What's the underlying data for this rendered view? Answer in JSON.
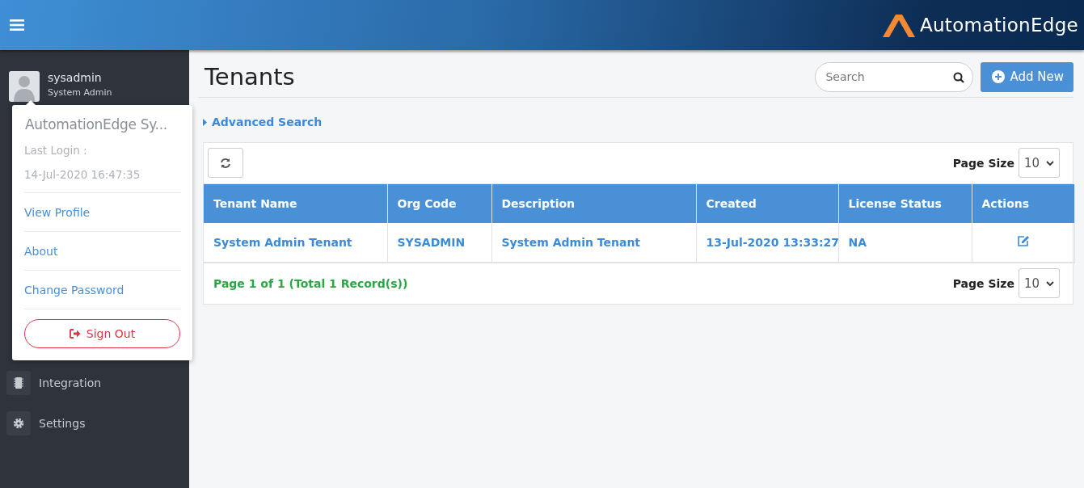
{
  "header": {
    "logo_text": "AutomationEdge"
  },
  "user": {
    "name": "sysadmin",
    "role": "System Admin"
  },
  "profile_menu": {
    "title": "AutomationEdge Sy...",
    "last_login_label": "Last Login :",
    "last_login": "14-Jul-2020 16:47:35",
    "links": [
      "View Profile",
      "About",
      "Change Password"
    ],
    "sign_out": "Sign Out"
  },
  "sidebar": {
    "items": [
      {
        "label": "Integration",
        "selected": false
      },
      {
        "label": "Settings",
        "selected": false
      }
    ]
  },
  "page": {
    "title": "Tenants",
    "search": {
      "placeholder": "Search"
    },
    "add_button": "Add New",
    "advanced_search": "Advanced Search"
  },
  "table": {
    "page_size_label": "Page Size",
    "page_size": "10",
    "columns": [
      "Tenant Name",
      "Org Code",
      "Description",
      "Created",
      "License Status",
      "Actions"
    ],
    "rows": [
      [
        "System Admin Tenant",
        "SYSADMIN",
        "System Admin Tenant",
        "13-Jul-2020 13:33:27",
        "NA"
      ]
    ],
    "footer": "Page 1 of 1 (Total 1 Record(s))",
    "footer_page_size_label": "Page Size",
    "footer_page_size": "10"
  }
}
